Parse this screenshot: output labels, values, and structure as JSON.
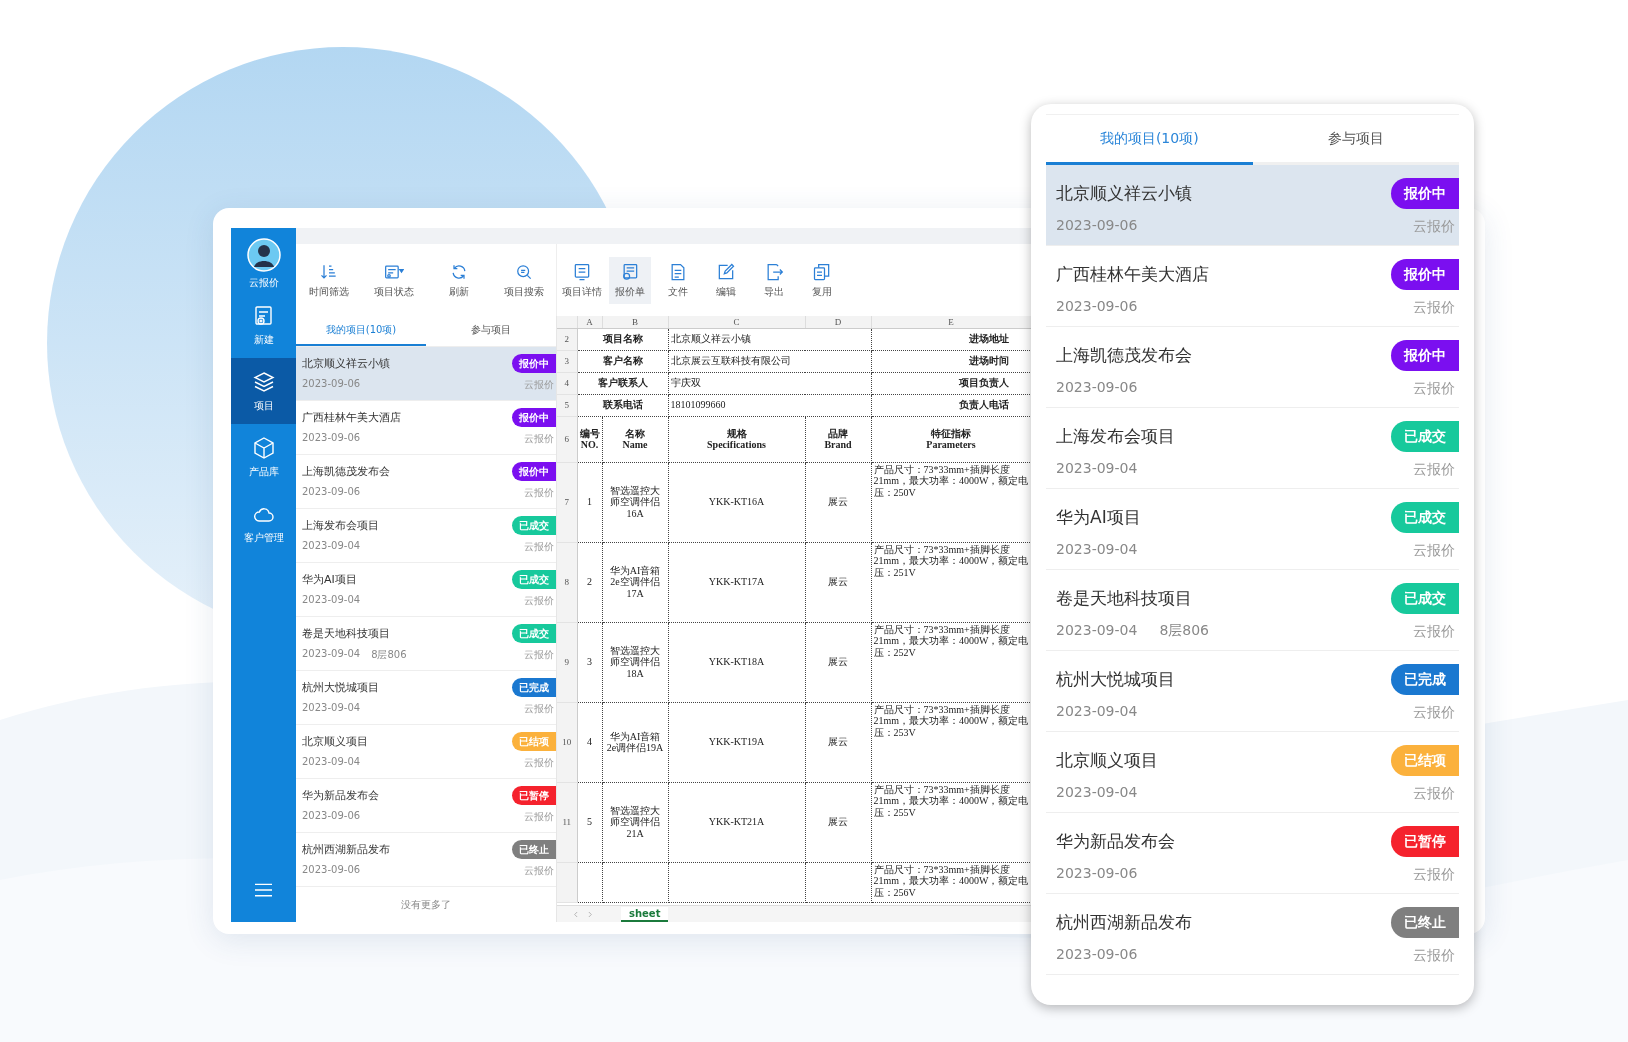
{
  "app": {
    "sidebar": {
      "brand": "云报价",
      "items": [
        {
          "label": "新建",
          "kind": "new",
          "selected": false
        },
        {
          "label": "项目",
          "kind": "layers",
          "selected": true
        },
        {
          "label": "产品库",
          "kind": "cube",
          "selected": false
        },
        {
          "label": "客户管理",
          "kind": "cloud",
          "selected": false
        }
      ]
    },
    "toolbar": {
      "left": [
        {
          "label": "时间筛选",
          "kind": "sort",
          "selected": false
        },
        {
          "label": "项目状态",
          "kind": "status",
          "selected": false
        },
        {
          "label": "刷新",
          "kind": "refresh",
          "selected": false
        },
        {
          "label": "项目搜索",
          "kind": "search",
          "selected": false
        }
      ],
      "right": [
        {
          "label": "项目详情",
          "kind": "detail",
          "selected": false
        },
        {
          "label": "报价单",
          "kind": "quote",
          "selected": true
        },
        {
          "label": "文件",
          "kind": "file",
          "selected": false
        },
        {
          "label": "编辑",
          "kind": "edit",
          "selected": false
        },
        {
          "label": "导出",
          "kind": "export",
          "selected": false
        },
        {
          "label": "复用",
          "kind": "copy",
          "selected": false
        }
      ]
    },
    "tabs": [
      {
        "label": "我的项目(10项)",
        "selected": true
      },
      {
        "label": "参与项目",
        "selected": false
      }
    ],
    "projects": [
      {
        "name": "北京顺义祥云小镇",
        "date": "2023-09-06",
        "status": "报价中",
        "color": "#7b0ff0",
        "source": "云报价",
        "selected": true
      },
      {
        "name": "广西桂林午美大酒店",
        "date": "2023-09-06",
        "status": "报价中",
        "color": "#7b0ff0",
        "source": "云报价",
        "selected": false
      },
      {
        "name": "上海凯德茂发布会",
        "date": "2023-09-06",
        "status": "报价中",
        "color": "#7b0ff0",
        "source": "云报价",
        "selected": false
      },
      {
        "name": "上海发布会项目",
        "date": "2023-09-04",
        "status": "已成交",
        "color": "#17c99c",
        "source": "云报价",
        "selected": false
      },
      {
        "name": "华为AI项目",
        "date": "2023-09-04",
        "status": "已成交",
        "color": "#17c99c",
        "source": "云报价",
        "selected": false
      },
      {
        "name": "卷是天地科技项目",
        "date": "2023-09-04",
        "extra": "8层806",
        "status": "已成交",
        "color": "#17c99c",
        "source": "云报价",
        "selected": false
      },
      {
        "name": "杭州大悦城项目",
        "date": "2023-09-04",
        "status": "已完成",
        "color": "#1a78d0",
        "source": "云报价",
        "selected": false
      },
      {
        "name": "北京顺义项目",
        "date": "2023-09-04",
        "status": "已结项",
        "color": "#fbb13c",
        "source": "云报价",
        "selected": false
      },
      {
        "name": "华为新品发布会",
        "date": "2023-09-06",
        "status": "已暂停",
        "color": "#f5222d",
        "source": "云报价",
        "selected": false
      },
      {
        "name": "杭州西湖新品发布",
        "date": "2023-09-06",
        "status": "已终止",
        "color": "#7f7f7f",
        "source": "云报价",
        "selected": false
      }
    ],
    "list_footer": "没有更多了",
    "sheet": {
      "columns": [
        "A",
        "B",
        "C",
        "D",
        "E"
      ],
      "info_rows": [
        {
          "row": "2",
          "label": "项目名称",
          "value": "北京顺义祥云小镇",
          "label_2": "进场地址"
        },
        {
          "row": "3",
          "label": "客户名称",
          "value": "北京展云互联科技有限公司",
          "label_2": "进场时间"
        },
        {
          "row": "4",
          "label": "客户联系人",
          "value": "宇庆双",
          "label_2": "项目负责人"
        },
        {
          "row": "5",
          "label": "联系电话",
          "value": "18101099660",
          "label_2": "负责人电话"
        }
      ],
      "header_row": {
        "row": "6",
        "cells": [
          "编号\nNO.",
          "名称\nName",
          "规格\nSpecifications",
          "品牌\nBrand",
          "特征指标\nParameters"
        ]
      },
      "items": [
        {
          "row": "7",
          "no": "1",
          "name": "智选遥控大师空调伴侣16A",
          "spec": "YKK-KT16A",
          "brand": "展云",
          "params": "产品尺寸：73*33mm+插脚长度21mm，最大功率：4000W，额定电压：250V"
        },
        {
          "row": "8",
          "no": "2",
          "name": "华为AI音箱2e空调伴侣17A",
          "spec": "YKK-KT17A",
          "brand": "展云",
          "params": "产品尺寸：73*33mm+插脚长度21mm，最大功率：4000W，额定电压：251V"
        },
        {
          "row": "9",
          "no": "3",
          "name": "智选遥控大师空调伴侣18A",
          "spec": "YKK-KT18A",
          "brand": "展云",
          "params": "产品尺寸：73*33mm+插脚长度21mm，最大功率：4000W，额定电压：252V"
        },
        {
          "row": "10",
          "no": "4",
          "name": "华为AI音箱2e调伴侣19A",
          "spec": "YKK-KT19A",
          "brand": "展云",
          "params": "产品尺寸：73*33mm+插脚长度21mm，最大功率：4000W，额定电压：253V"
        },
        {
          "row": "11",
          "no": "5",
          "name": "智选遥控大师空调伴侣21A",
          "spec": "YKK-KT21A",
          "brand": "展云",
          "params": "产品尺寸：73*33mm+插脚长度21mm，最大功率：4000W，额定电压：255V"
        }
      ],
      "partial_row": {
        "params": "产品尺寸：73*33mm+插脚长度21mm，最大功率：4000W，额定电压：256V"
      },
      "sheet_tabs": [
        {
          "label": "sheet",
          "selected": true
        }
      ]
    }
  },
  "phone": {
    "tabs": [
      {
        "label": "我的项目(10项)",
        "selected": true
      },
      {
        "label": "参与项目",
        "selected": false
      }
    ],
    "projects": [
      {
        "name": "北京顺义祥云小镇",
        "date": "2023-09-06",
        "status": "报价中",
        "color": "#7b0ff0",
        "source": "云报价",
        "selected": true
      },
      {
        "name": "广西桂林午美大酒店",
        "date": "2023-09-06",
        "status": "报价中",
        "color": "#7b0ff0",
        "source": "云报价",
        "selected": false
      },
      {
        "name": "上海凯德茂发布会",
        "date": "2023-09-06",
        "status": "报价中",
        "color": "#7b0ff0",
        "source": "云报价",
        "selected": false
      },
      {
        "name": "上海发布会项目",
        "date": "2023-09-04",
        "status": "已成交",
        "color": "#17c99c",
        "source": "云报价",
        "selected": false
      },
      {
        "name": "华为AI项目",
        "date": "2023-09-04",
        "status": "已成交",
        "color": "#17c99c",
        "source": "云报价",
        "selected": false
      },
      {
        "name": "卷是天地科技项目",
        "date": "2023-09-04",
        "extra": "8层806",
        "status": "已成交",
        "color": "#17c99c",
        "source": "云报价",
        "selected": false
      },
      {
        "name": "杭州大悦城项目",
        "date": "2023-09-04",
        "status": "已完成",
        "color": "#1a78d0",
        "source": "云报价",
        "selected": false
      },
      {
        "name": "北京顺义项目",
        "date": "2023-09-04",
        "status": "已结项",
        "color": "#fbb13c",
        "source": "云报价",
        "selected": false
      },
      {
        "name": "华为新品发布会",
        "date": "2023-09-06",
        "status": "已暂停",
        "color": "#f5222d",
        "source": "云报价",
        "selected": false
      },
      {
        "name": "杭州西湖新品发布",
        "date": "2023-09-06",
        "status": "已终止",
        "color": "#7f7f7f",
        "source": "云报价",
        "selected": false
      }
    ]
  }
}
